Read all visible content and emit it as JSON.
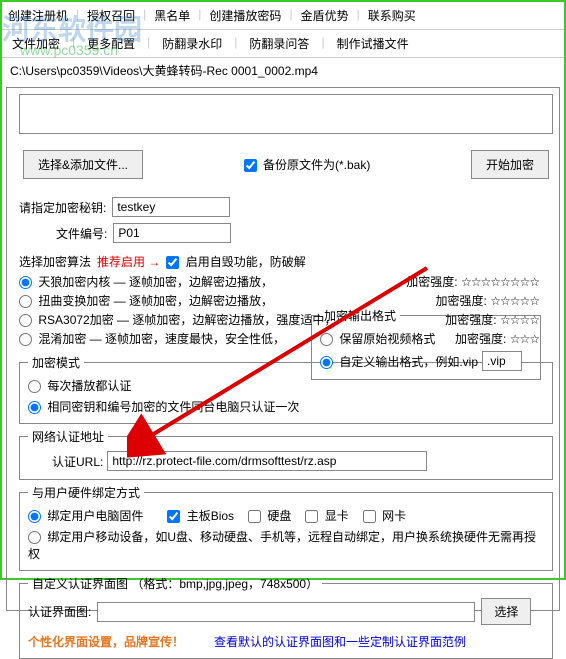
{
  "topTabs": [
    "创建注册机",
    "授权召回",
    "黑名单",
    "创建播放密码",
    "金盾优势",
    "联系购买"
  ],
  "secondTabs": [
    "文件加密",
    "更多配置",
    "防翻录水印",
    "防翻录问答",
    "制作试播文件"
  ],
  "filePath": "C:\\Users\\pc0359\\Videos\\大黄蜂转码-Rec 0001_0002.mp4",
  "watermark1": "河东软件园",
  "watermark2": "www.pc0359.cn",
  "buttons": {
    "selectFile": "选择&添加文件...",
    "startEncrypt": "开始加密",
    "select": "选择"
  },
  "checkboxes": {
    "backup": "备份原文件为(*.bak)",
    "enableSelfDestroy": "启用自毁功能，防破解",
    "mainboard": "主板Bios",
    "harddisk": "硬盘",
    "gpu": "显卡",
    "netcard": "网卡"
  },
  "labels": {
    "keyLabel": "请指定加密秘钥:",
    "fileIdLabel": "文件编号:",
    "keyValue": "testkey",
    "fileIdValue": "P01",
    "outputFormat": "加密输出格式",
    "keepOriginal": "保留原始视频格式",
    "customFormat": "自定义输出格式，例如.vip",
    "customFormatValue": ".vip",
    "algoTitle": "选择加密算法",
    "recommend": "推荐启用 →",
    "algo1": "天狼加密内核 — 逐帧加密，边解密边播放，",
    "algo2": "扭曲变换加密 — 逐帧加密，边解密边播放，",
    "algo3": "RSA3072加密 — 逐帧加密，边解密边播放，强度适中，",
    "algo4": "混淆加密    — 逐帧加密，速度最快，安全性低，",
    "strengthLabel": "加密强度:",
    "stars5": "☆☆☆☆☆☆☆☆",
    "stars4": "☆☆☆☆☆",
    "stars3": "☆☆☆☆",
    "stars2": "☆☆☆",
    "authMode": "加密模式",
    "authEach": "每次播放都认证",
    "authSameKey": "相同密钥和编号加密的文件同台电脑只认证一次",
    "netAuthTitle": "网络认证地址",
    "authUrlLabel": "认证URL:",
    "authUrlValue": "http://rz.protect-file.com/drmsofttest/rz.asp",
    "hwBindTitle": "与用户硬件绑定方式",
    "bindPC": "绑定用户电脑固件",
    "bindMobile": "绑定用户移动设备，如U盘、移动硬盘、手机等，远程自动绑定，用户换系统换硬件无需再授权",
    "customUITitle": "自定义认证界面图 （格式：bmp,jpg,jpeg，748x500）",
    "authUIImg": "认证界面图:",
    "personalize": "个性化界面设置，品牌宣传！",
    "viewDefault": "查看默认的认证界面图和一些定制认证界面范例"
  }
}
